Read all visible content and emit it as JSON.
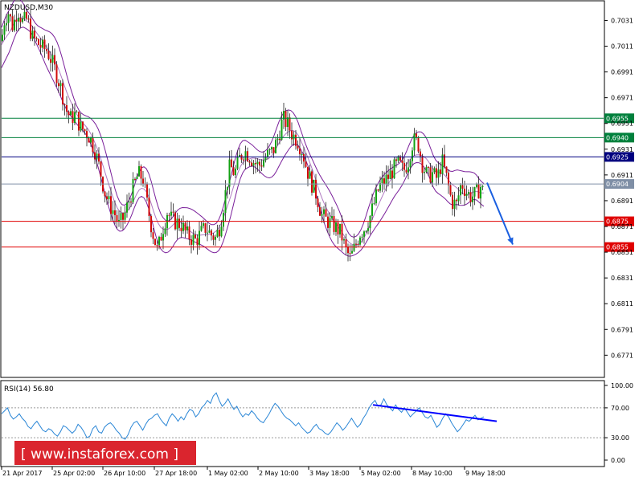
{
  "window_label": "NZDUSD,M30",
  "rsi_label": "RSI(14) 56.80",
  "watermark": "[ www.instaforex.com ]",
  "colors": {
    "green_level": "#00803c",
    "blue_level": "#00007f",
    "gray_level": "#7f8fa6",
    "red_level": "#e00000",
    "bollinger": "#7a1f9a",
    "bull": "#13a113",
    "bear": "#d10b0b",
    "wick": "#222222",
    "rsi_line": "#2a86d6",
    "trend": "#0000ff",
    "arrow": "#1a5fe0",
    "watermark_bg": "#d7121c"
  },
  "chart_data": [
    {
      "type": "candlestick",
      "title": "NZDUSD,M30",
      "ylim": [
        0.6755,
        0.7045
      ],
      "y_ticks": [
        "0.7031",
        "0.7011",
        "0.6991",
        "0.6971",
        "0.6951",
        "0.6931",
        "0.6911",
        "0.6891",
        "0.6871",
        "0.6851",
        "0.6831",
        "0.6811",
        "0.6791",
        "0.6771"
      ],
      "x_ticks": [
        "21 Apr 2017",
        "25 Apr 02:00",
        "26 Apr 10:00",
        "27 Apr 18:00",
        "1 May 02:00",
        "2 May 10:00",
        "3 May 18:00",
        "5 May 02:00",
        "8 May 10:00",
        "9 May 18:00"
      ],
      "close_path": [
        [
          0,
          0.7005
        ],
        [
          5,
          0.703
        ],
        [
          10,
          0.7038
        ],
        [
          16,
          0.7026
        ],
        [
          22,
          0.704
        ],
        [
          28,
          0.703
        ],
        [
          34,
          0.7032
        ],
        [
          40,
          0.7018
        ],
        [
          46,
          0.7014
        ],
        [
          52,
          0.701
        ],
        [
          58,
          0.7008
        ],
        [
          64,
          0.7
        ],
        [
          70,
          0.699
        ],
        [
          76,
          0.6978
        ],
        [
          82,
          0.6962
        ],
        [
          88,
          0.6955
        ],
        [
          94,
          0.6958
        ],
        [
          100,
          0.6948
        ],
        [
          106,
          0.6945
        ],
        [
          112,
          0.694
        ],
        [
          118,
          0.693
        ],
        [
          124,
          0.6916
        ],
        [
          130,
          0.6898
        ],
        [
          136,
          0.6888
        ],
        [
          142,
          0.6882
        ],
        [
          148,
          0.6872
        ],
        [
          154,
          0.6878
        ],
        [
          160,
          0.689
        ],
        [
          166,
          0.6902
        ],
        [
          172,
          0.6912
        ],
        [
          178,
          0.6908
        ],
        [
          184,
          0.6885
        ],
        [
          190,
          0.6866
        ],
        [
          196,
          0.6852
        ],
        [
          202,
          0.6868
        ],
        [
          208,
          0.6882
        ],
        [
          214,
          0.6876
        ],
        [
          220,
          0.6874
        ],
        [
          226,
          0.6872
        ],
        [
          232,
          0.6865
        ],
        [
          238,
          0.6862
        ],
        [
          244,
          0.686
        ],
        [
          250,
          0.6866
        ],
        [
          256,
          0.687
        ],
        [
          262,
          0.6865
        ],
        [
          268,
          0.6862
        ],
        [
          274,
          0.6872
        ],
        [
          280,
          0.6895
        ],
        [
          286,
          0.6918
        ],
        [
          292,
          0.6912
        ],
        [
          298,
          0.6924
        ],
        [
          304,
          0.693
        ],
        [
          310,
          0.6926
        ],
        [
          316,
          0.6921
        ],
        [
          322,
          0.6918
        ],
        [
          328,
          0.6923
        ],
        [
          334,
          0.6927
        ],
        [
          340,
          0.693
        ],
        [
          346,
          0.694
        ],
        [
          352,
          0.6955
        ],
        [
          358,
          0.695
        ],
        [
          364,
          0.6942
        ],
        [
          370,
          0.6938
        ],
        [
          376,
          0.693
        ],
        [
          382,
          0.6915
        ],
        [
          388,
          0.6904
        ],
        [
          394,
          0.6895
        ],
        [
          400,
          0.688
        ],
        [
          406,
          0.6876
        ],
        [
          412,
          0.6873
        ],
        [
          418,
          0.687
        ],
        [
          424,
          0.6866
        ],
        [
          430,
          0.6853
        ],
        [
          436,
          0.6846
        ],
        [
          442,
          0.6856
        ],
        [
          448,
          0.6866
        ],
        [
          454,
          0.687
        ],
        [
          460,
          0.6878
        ],
        [
          466,
          0.689
        ],
        [
          472,
          0.6902
        ],
        [
          478,
          0.6906
        ],
        [
          484,
          0.691
        ],
        [
          490,
          0.6916
        ],
        [
          496,
          0.692
        ],
        [
          502,
          0.6914
        ],
        [
          508,
          0.6922
        ],
        [
          514,
          0.6938
        ],
        [
          520,
          0.6936
        ],
        [
          526,
          0.6918
        ],
        [
          532,
          0.691
        ],
        [
          538,
          0.6912
        ],
        [
          544,
          0.6908
        ],
        [
          550,
          0.6922
        ],
        [
          556,
          0.6908
        ],
        [
          562,
          0.689
        ],
        [
          568,
          0.6888
        ],
        [
          574,
          0.6905
        ],
        [
          580,
          0.6898
        ],
        [
          586,
          0.6894
        ],
        [
          592,
          0.6896
        ],
        [
          598,
          0.6902
        ],
        [
          602,
          0.6897
        ]
      ],
      "bands_offset": 0.0012,
      "levels": [
        {
          "value": "0.6955",
          "color": "green"
        },
        {
          "value": "0.6940",
          "color": "green"
        },
        {
          "value": "0.6925",
          "color": "blue"
        },
        {
          "value": "0.6904",
          "color": "gray"
        },
        {
          "value": "0.6875",
          "color": "red"
        },
        {
          "value": "0.6855",
          "color": "red"
        }
      ],
      "forecast_arrow": {
        "from": [
          606,
          0.6905
        ],
        "to": [
          638,
          0.6857
        ]
      }
    },
    {
      "type": "line",
      "title": "RSI(14) 56.80",
      "ylim": [
        0,
        100
      ],
      "y_ticks": [
        "100.00",
        "70.00",
        "30.00",
        "0.00"
      ],
      "guide_levels": [
        70,
        30
      ],
      "values": [
        62,
        66,
        70,
        60,
        55,
        58,
        62,
        56,
        52,
        45,
        42,
        48,
        52,
        46,
        40,
        38,
        42,
        40,
        35,
        32,
        38,
        46,
        44,
        40,
        36,
        40,
        48,
        44,
        38,
        30,
        32,
        42,
        46,
        38,
        36,
        44,
        48,
        50,
        46,
        40,
        36,
        30,
        28,
        34,
        44,
        50,
        52,
        46,
        40,
        48,
        54,
        56,
        60,
        62,
        55,
        50,
        46,
        56,
        62,
        58,
        52,
        58,
        54,
        62,
        68,
        66,
        58,
        62,
        70,
        74,
        80,
        76,
        86,
        90,
        80,
        72,
        76,
        82,
        74,
        68,
        72,
        64,
        58,
        62,
        60,
        66,
        62,
        56,
        52,
        50,
        56,
        62,
        70,
        76,
        72,
        66,
        60,
        56,
        54,
        50,
        46,
        50,
        44,
        40,
        36,
        38,
        44,
        48,
        42,
        40,
        36,
        34,
        38,
        44,
        50,
        46,
        40,
        44,
        50,
        56,
        50,
        44,
        48,
        56,
        62,
        70,
        76,
        80,
        72,
        74,
        82,
        74,
        70,
        66,
        74,
        68,
        64,
        70,
        64,
        58,
        62,
        66,
        70,
        64,
        58,
        56,
        60,
        52,
        44,
        48,
        56,
        62,
        58,
        50,
        44,
        38,
        42,
        48,
        54,
        52,
        56,
        60,
        54,
        56,
        58
      ],
      "trend": {
        "from": [
          464,
          74
        ],
        "to": [
          618,
          52
        ]
      }
    }
  ]
}
